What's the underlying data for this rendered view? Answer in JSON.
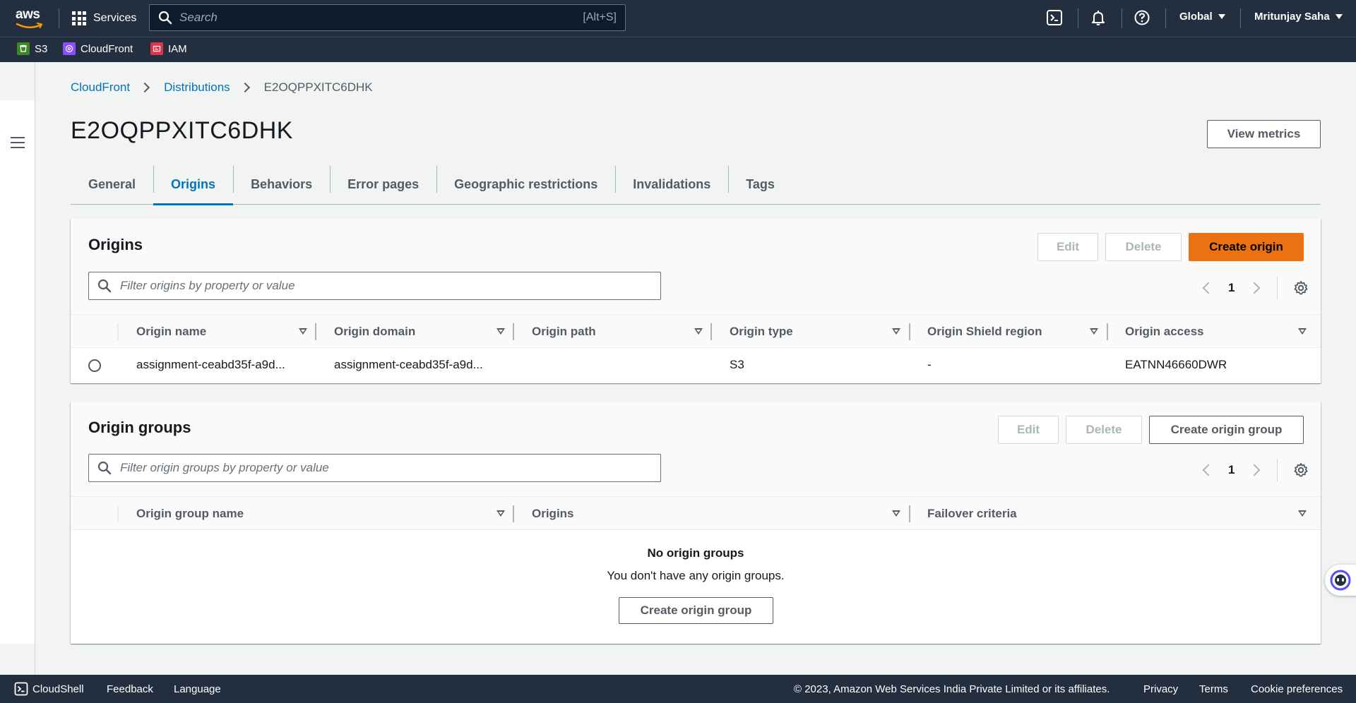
{
  "topnav": {
    "logo_text": "aws",
    "services_label": "Services",
    "search_placeholder": "Search",
    "search_shortcut": "[Alt+S]",
    "region_label": "Global",
    "user_label": "Mritunjay Saha",
    "bg_color": "#232f3e"
  },
  "favorites": [
    {
      "label": "S3",
      "icon": "s3-icon",
      "color": "#3f8624"
    },
    {
      "label": "CloudFront",
      "icon": "cloudfront-icon",
      "color": "#8c4fff"
    },
    {
      "label": "IAM",
      "icon": "iam-icon",
      "color": "#dd344c"
    }
  ],
  "breadcrumb": {
    "items": [
      "CloudFront",
      "Distributions"
    ],
    "current": "E2OQPPXITC6DHK"
  },
  "page": {
    "title": "E2OQPPXITC6DHK",
    "view_metrics_label": "View metrics"
  },
  "tabs": [
    {
      "label": "General",
      "active": false
    },
    {
      "label": "Origins",
      "active": true
    },
    {
      "label": "Behaviors",
      "active": false
    },
    {
      "label": "Error pages",
      "active": false
    },
    {
      "label": "Geographic restrictions",
      "active": false
    },
    {
      "label": "Invalidations",
      "active": false
    },
    {
      "label": "Tags",
      "active": false
    }
  ],
  "origins_panel": {
    "title": "Origins",
    "edit_label": "Edit",
    "delete_label": "Delete",
    "create_label": "Create origin",
    "filter_placeholder": "Filter origins by property or value",
    "page_number": "1",
    "columns": [
      "Origin name",
      "Origin domain",
      "Origin path",
      "Origin type",
      "Origin Shield region",
      "Origin access"
    ],
    "rows": [
      {
        "origin_name": "assignment-ceabd35f-a9d...",
        "origin_domain": "assignment-ceabd35f-a9d...",
        "origin_path": "",
        "origin_type": "S3",
        "origin_shield_region": "-",
        "origin_access": "EATNN46660DWR"
      }
    ]
  },
  "origin_groups_panel": {
    "title": "Origin groups",
    "edit_label": "Edit",
    "delete_label": "Delete",
    "create_label": "Create origin group",
    "filter_placeholder": "Filter origin groups by property or value",
    "page_number": "1",
    "columns": [
      "Origin group name",
      "Origins",
      "Failover criteria"
    ],
    "empty_title": "No origin groups",
    "empty_text": "You don't have any origin groups.",
    "empty_create_label": "Create origin group"
  },
  "footer": {
    "cloudshell_label": "CloudShell",
    "feedback_label": "Feedback",
    "language_label": "Language",
    "copyright": "© 2023, Amazon Web Services India Private Limited or its affiliates.",
    "privacy_label": "Privacy",
    "terms_label": "Terms",
    "cookie_label": "Cookie preferences"
  },
  "colors": {
    "accent": "#0073bb",
    "primary_button": "#ec7211"
  }
}
